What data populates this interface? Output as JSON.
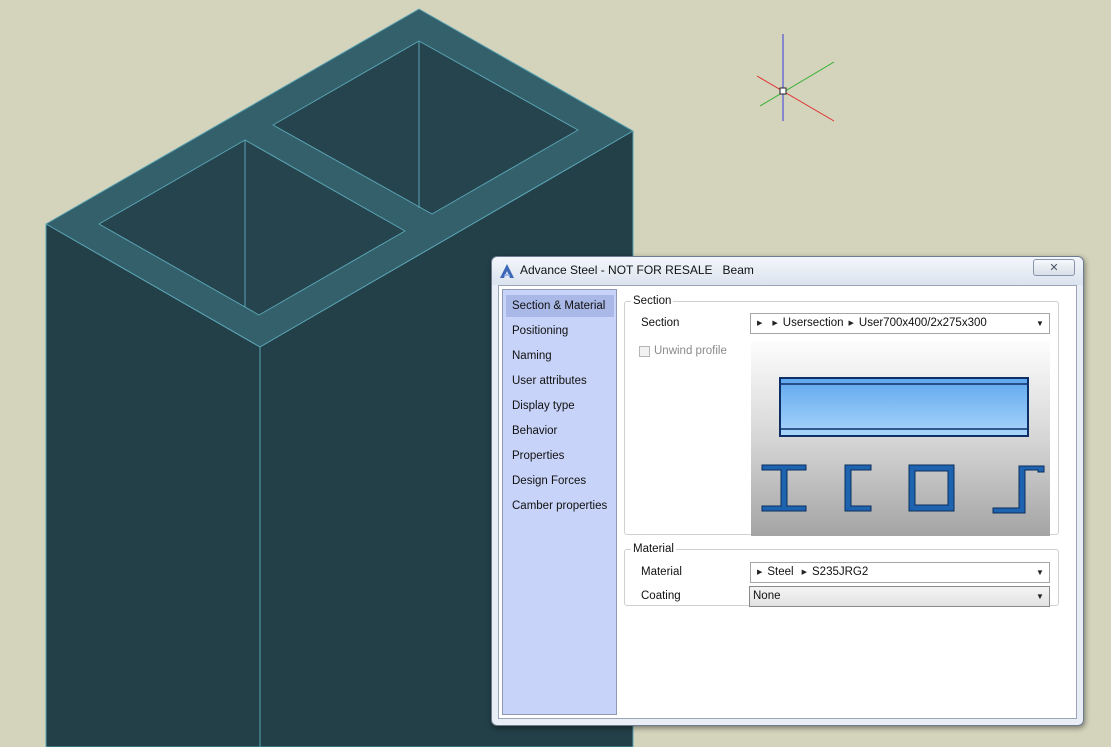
{
  "dialog": {
    "title": "Advance Steel - NOT FOR RESALE   Beam",
    "close_glyph": "✕"
  },
  "nav": {
    "items": [
      {
        "label": "Section & Material",
        "active": true
      },
      {
        "label": "Positioning"
      },
      {
        "label": "Naming"
      },
      {
        "label": "User attributes"
      },
      {
        "label": "Display type"
      },
      {
        "label": "Behavior"
      },
      {
        "label": "Properties"
      },
      {
        "label": "Design Forces"
      },
      {
        "label": "Camber properties"
      }
    ]
  },
  "section_group": {
    "legend": "Section",
    "section_label": "Section",
    "section_path": [
      "",
      "Usersection",
      "User700x400/2x275x300"
    ],
    "unwind_label": "Unwind profile"
  },
  "material_group": {
    "legend": "Material",
    "material_label": "Material",
    "material_path": [
      "Steel",
      "S235JRG2"
    ],
    "coating_label": "Coating",
    "coating_value": "None"
  },
  "colors": {
    "background": "#d4d4bc",
    "model_face": "#233f48",
    "model_top": "#34606c",
    "model_edge": "#5aa3b3",
    "preview_profile": "#1d63b0"
  },
  "icons": {
    "app": "advance-steel-logo-icon",
    "ucs": "ucs-axes-icon",
    "close": "close-icon",
    "profiles": [
      "i-beam-profile-icon",
      "channel-profile-icon",
      "box-profile-icon",
      "z-profile-icon"
    ]
  }
}
